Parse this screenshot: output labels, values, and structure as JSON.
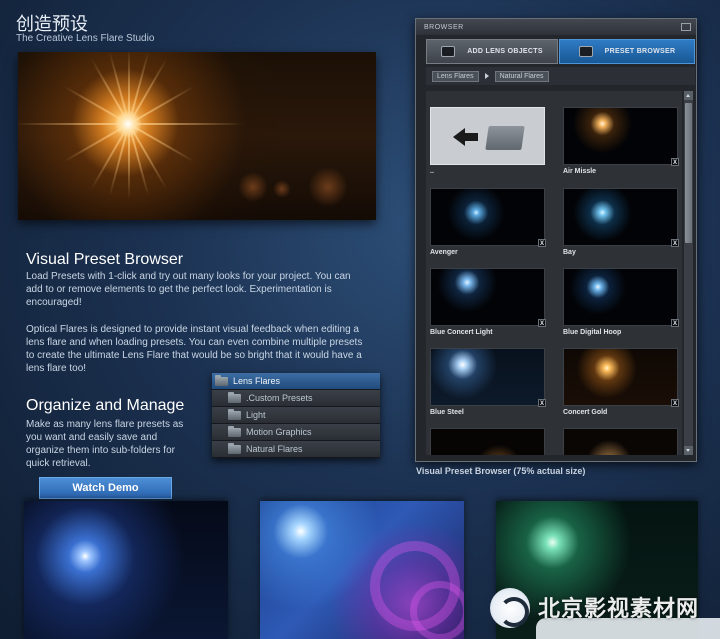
{
  "header": {
    "title_cn": "创造预设",
    "subtitle": "The Creative Lens Flare Studio"
  },
  "visual_preset": {
    "title": "Visual Preset Browser",
    "text1": "Load Presets with 1-click and try out many looks for your project. You can add to or remove elements to get the perfect look. Experimentation is encouraged!",
    "text2": "Optical Flares is designed to provide instant visual feedback when editing a lens flare and when loading presets. You can even combine multiple presets to create the ultimate Lens Flare that would be so bright that it would have a lens flare too!"
  },
  "organize": {
    "title": "Organize and Manage",
    "text": "Make as many lens flare presets as you want and easily save and organize them into sub-folders for quick retrieval."
  },
  "tree": {
    "root": "Lens Flares",
    "children": [
      ".Custom Presets",
      "Light",
      "Motion Graphics",
      "Natural Flares"
    ]
  },
  "watch_demo": "Watch Demo",
  "browser": {
    "title": "BROWSER",
    "tab_add": "ADD LENS OBJECTS",
    "tab_preset": "PRESET BROWSER",
    "crumbs": [
      "Lens Flares",
      "Natural Flares"
    ],
    "presets": [
      "..",
      "Air Missle",
      "Avenger",
      "Bay",
      "Blue Concert Light",
      "Blue Digital Hoop",
      "Blue Steel",
      "Concert Gold"
    ],
    "delete_label": "X",
    "scroll_position": 0.0
  },
  "browser_caption": "Visual Preset Browser (75% actual size)",
  "watermark": "北京影视素材网",
  "icons": [
    "folder-icon",
    "back-arrow-icon",
    "window-restore-icon",
    "scroll-up-icon",
    "scroll-down-icon",
    "lens-object-icon",
    "preset-browser-icon",
    "watermark-logo-icon"
  ]
}
